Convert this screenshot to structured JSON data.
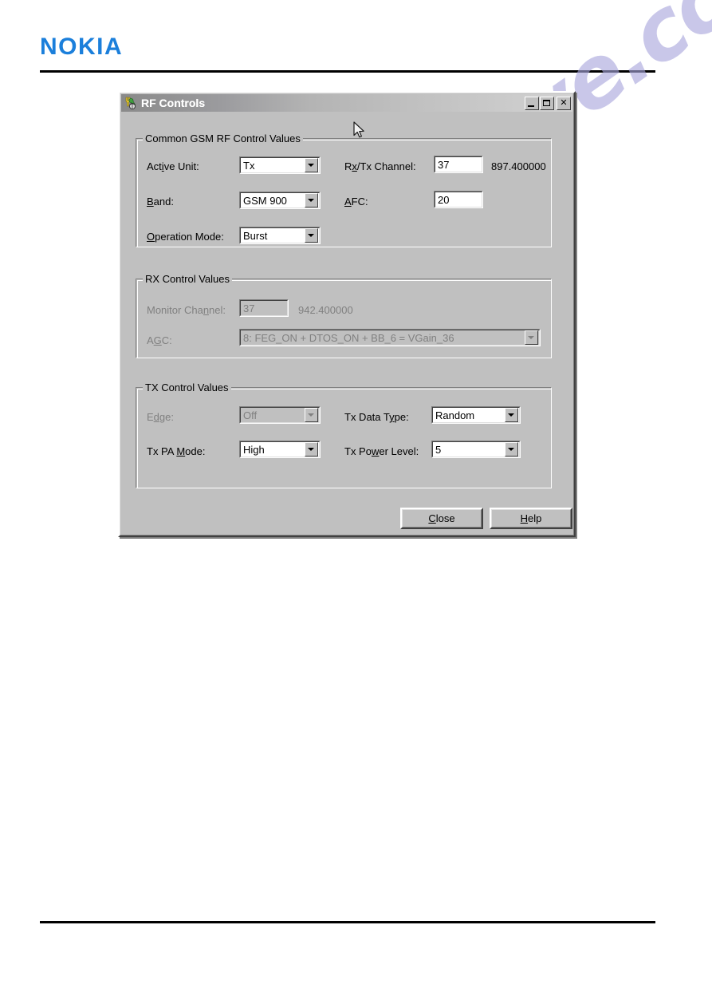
{
  "page": {
    "brand": "NOKIA",
    "brand_color": "#1b7fdb",
    "watermark": "manualshive.com",
    "watermark_color": "#a9a6dd"
  },
  "dialog": {
    "title": "RF Controls",
    "icon": "rf-tool-icon",
    "window_buttons": [
      {
        "name": "minimize-button",
        "glyph": "_"
      },
      {
        "name": "maximize-button",
        "glyph": "□"
      },
      {
        "name": "close-button",
        "glyph": "×"
      }
    ],
    "groups": {
      "common": {
        "title": "Common GSM RF Control Values",
        "enabled": true,
        "fields": {
          "active_unit": {
            "label": "Act",
            "label_mnemonic": "i",
            "label_rest": "ve Unit:",
            "value": "Tx"
          },
          "band": {
            "label": "",
            "label_mnemonic": "B",
            "label_rest": "and:",
            "value": "GSM 900"
          },
          "operation_mode": {
            "label": "",
            "label_mnemonic": "O",
            "label_rest": "peration Mode:",
            "value": "Burst"
          },
          "rx_tx_channel": {
            "label": "R",
            "label_mnemonic": "x",
            "label_rest": "/Tx Channel:",
            "value": "37",
            "readout": "897.400000"
          },
          "afc": {
            "label": "",
            "label_mnemonic": "A",
            "label_rest": "FC:",
            "value": "20"
          }
        }
      },
      "rx": {
        "title": "RX Control Values",
        "enabled": false,
        "fields": {
          "monitor_channel": {
            "label": "Monitor Cha",
            "label_mnemonic": "n",
            "label_rest": "nel:",
            "value": "37",
            "readout": "942.400000"
          },
          "agc": {
            "label": "A",
            "label_mnemonic": "G",
            "label_rest": "C:",
            "value": "8: FEG_ON + DTOS_ON + BB_6 = VGain_36"
          }
        }
      },
      "tx": {
        "title": "TX Control Values",
        "enabled": true,
        "fields": {
          "edge": {
            "label": "E",
            "label_mnemonic": "d",
            "label_rest": "ge:",
            "value": "Off",
            "enabled": false
          },
          "tx_pa_mode": {
            "label": "Tx PA ",
            "label_mnemonic": "M",
            "label_rest": "ode:",
            "value": "High",
            "enabled": true
          },
          "tx_data_type": {
            "label": "Tx Data T",
            "label_mnemonic": "y",
            "label_rest": "pe:",
            "value": "Random",
            "enabled": true
          },
          "tx_power_level": {
            "label": "Tx Po",
            "label_mnemonic": "w",
            "label_rest": "er Level:",
            "value": "5",
            "enabled": true
          }
        }
      }
    },
    "buttons": {
      "close": {
        "label": "C",
        "label_mnemonic": "C",
        "label_rest": "lose",
        "text": "Close"
      },
      "help": {
        "label": "H",
        "label_mnemonic": "H",
        "label_rest": "elp",
        "text": "Help"
      }
    }
  }
}
